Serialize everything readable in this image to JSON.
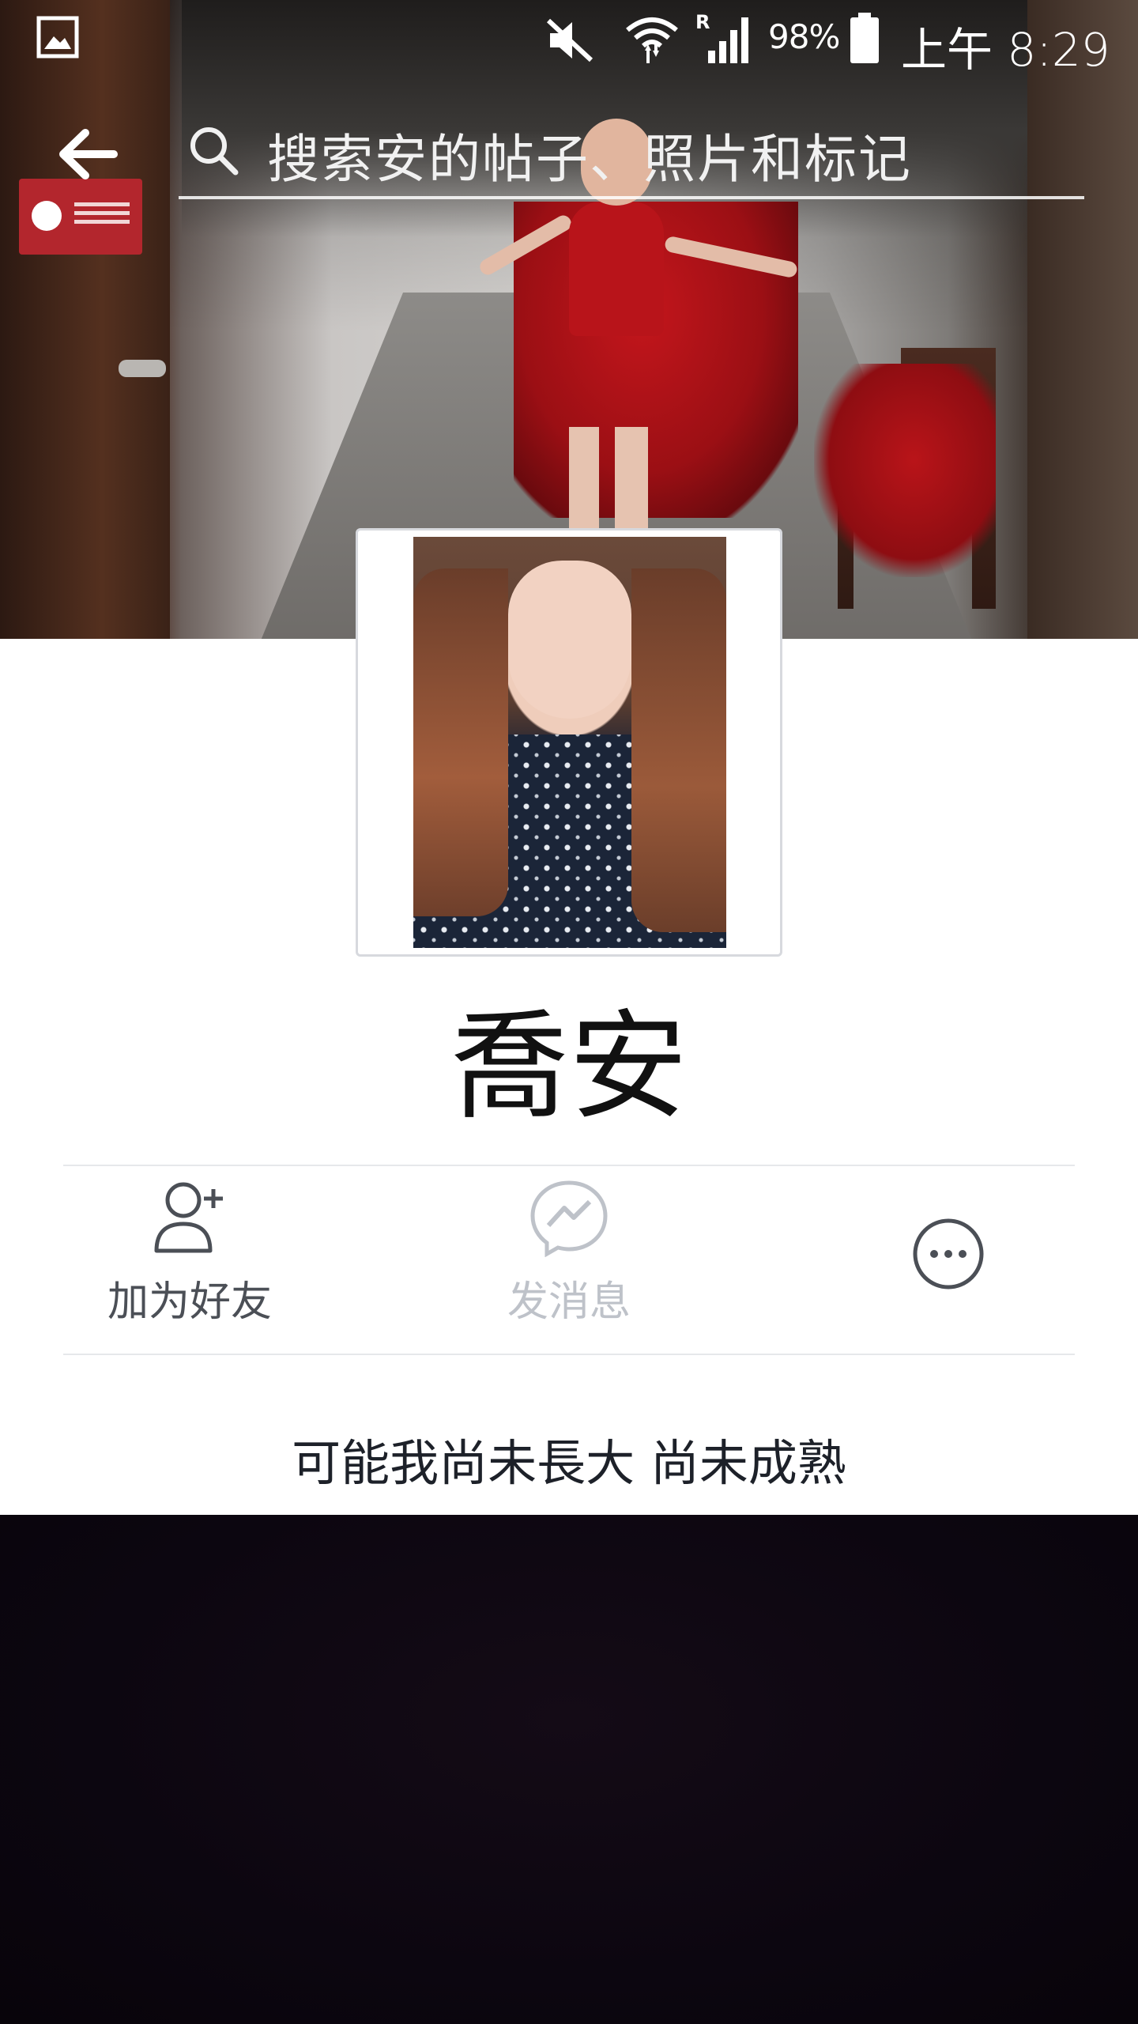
{
  "status_bar": {
    "battery_percent": "98%",
    "time": "上午 8:29",
    "icons": [
      "gallery-icon",
      "mute-icon",
      "wifi-icon",
      "signal-roaming-icon",
      "battery-icon"
    ]
  },
  "search": {
    "placeholder": "搜索安的帖子、照片和标记"
  },
  "profile": {
    "name": "喬安",
    "bio": "可能我尚未長大 尚未成熟"
  },
  "actions": {
    "add_friend": "加为好友",
    "message": "发消息",
    "more_icon": "more-options-icon"
  },
  "colors": {
    "label_active": "#4b4f56",
    "label_disabled": "#bec2c9",
    "divider": "#e6e8eb"
  }
}
